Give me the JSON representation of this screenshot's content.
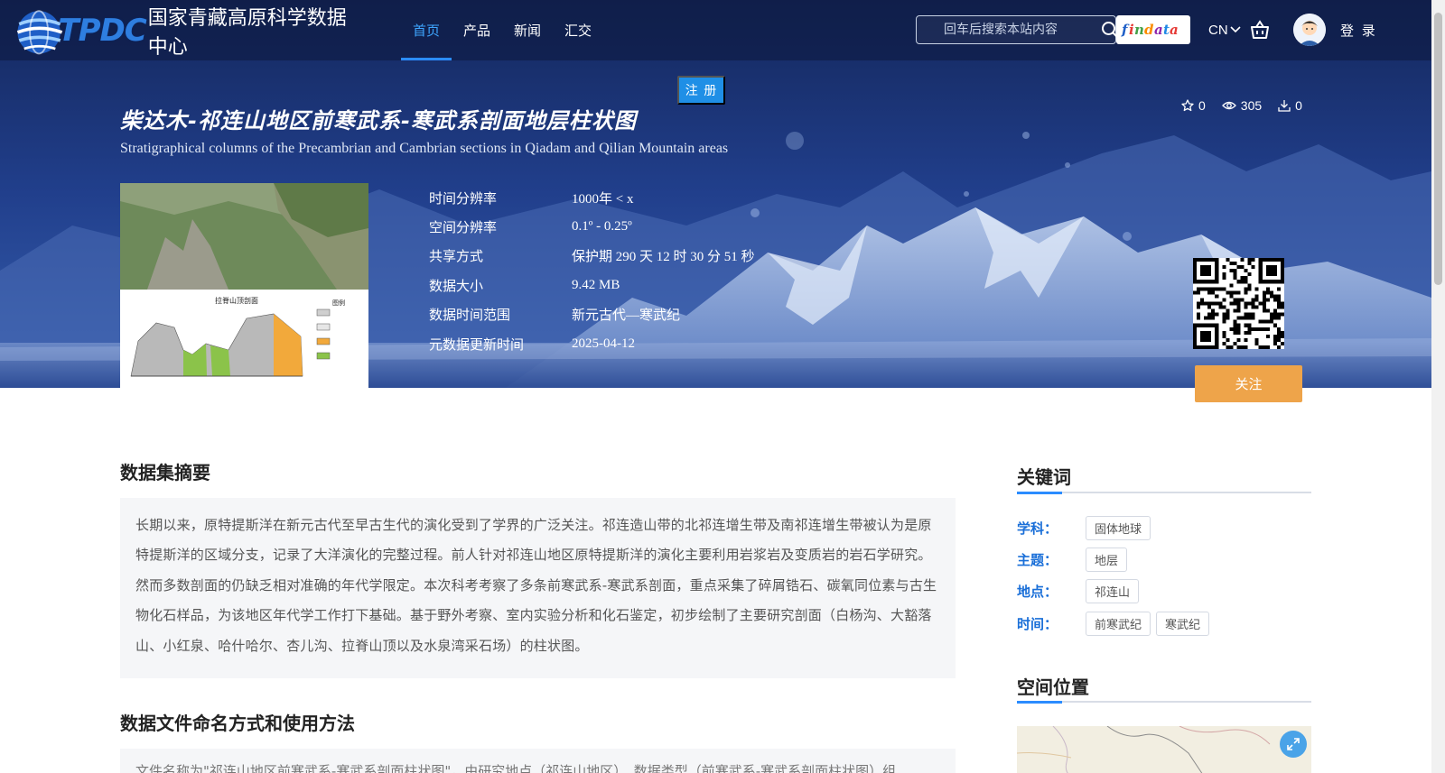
{
  "nav": {
    "logo_text": "TPDC",
    "logo_name": "国家青藏高原科学数据中心",
    "menu": [
      {
        "label": "首页",
        "active": true
      },
      {
        "label": "产品",
        "active": false
      },
      {
        "label": "新闻",
        "active": false
      },
      {
        "label": "汇交",
        "active": false
      }
    ],
    "search_placeholder": "回车后搜索本站内容",
    "findata_label": "findata",
    "lang": "CN",
    "login": "登 录",
    "register": "注 册"
  },
  "dataset": {
    "title_cn": "柴达木-祁连山地区前寒武系-寒武系剖面地层柱状图",
    "title_en": "Stratigraphical columns of the Precambrian and Cambrian sections in Qiadam and Qilian Mountain areas",
    "stats": {
      "stars": "0",
      "views": "305",
      "downloads": "0"
    },
    "meta": [
      {
        "label": "时间分辨率",
        "value": "1000年 < x"
      },
      {
        "label": "空间分辨率",
        "value": "0.1º - 0.25º"
      },
      {
        "label": "共享方式",
        "value": "保护期 290 天 12 时 30 分 51 秒"
      },
      {
        "label": "数据大小",
        "value": "9.42 MB"
      },
      {
        "label": "数据时间范围",
        "value": "新元古代—寒武纪"
      },
      {
        "label": "元数据更新时间",
        "value": "2025-04-12"
      }
    ],
    "follow": "关注",
    "thumb_title": "拉脊山顶剖面",
    "thumb_legend_title": "图例"
  },
  "main": {
    "abstract_heading": "数据集摘要",
    "abstract_text": "长期以来，原特提斯洋在新元古代至早古生代的演化受到了学界的广泛关注。祁连造山带的北祁连增生带及南祁连增生带被认为是原特提斯洋的区域分支，记录了大洋演化的完整过程。前人针对祁连山地区原特提斯洋的演化主要利用岩浆岩及变质岩的岩石学研究。然而多数剖面的仍缺乏相对准确的年代学限定。本次科考考察了多条前寒武系-寒武系剖面，重点采集了碎屑锆石、碳氧同位素与古生物化石样品，为该地区年代学工作打下基础。基于野外考察、室内实验分析和化石鉴定，初步绘制了主要研究剖面（白杨沟、大豁落山、小红泉、哈什哈尔、杏儿沟、拉脊山顶以及水泉湾采石场）的柱状图。",
    "usage_heading": "数据文件命名方式和使用方法",
    "usage_text": "文件名称为\"祁连山地区前寒武系-寒武系剖面柱状图\"，由研究地点（祁连山地区）、数据类型（前寒武系-寒武系剖面柱状图）组"
  },
  "sidebar": {
    "keywords_heading": "关键词",
    "keywords": [
      {
        "label": "学科：",
        "tags": [
          "固体地球"
        ]
      },
      {
        "label": "主题：",
        "tags": [
          "地层"
        ]
      },
      {
        "label": "地点：",
        "tags": [
          "祁连山"
        ]
      },
      {
        "label": "时间：",
        "tags": [
          "前寒武纪",
          "寒武纪"
        ]
      }
    ],
    "location_heading": "空间位置"
  },
  "colors": {
    "accent": "#2b8cff",
    "follow": "#eea44a",
    "keyword_label": "#1a6fd8"
  }
}
